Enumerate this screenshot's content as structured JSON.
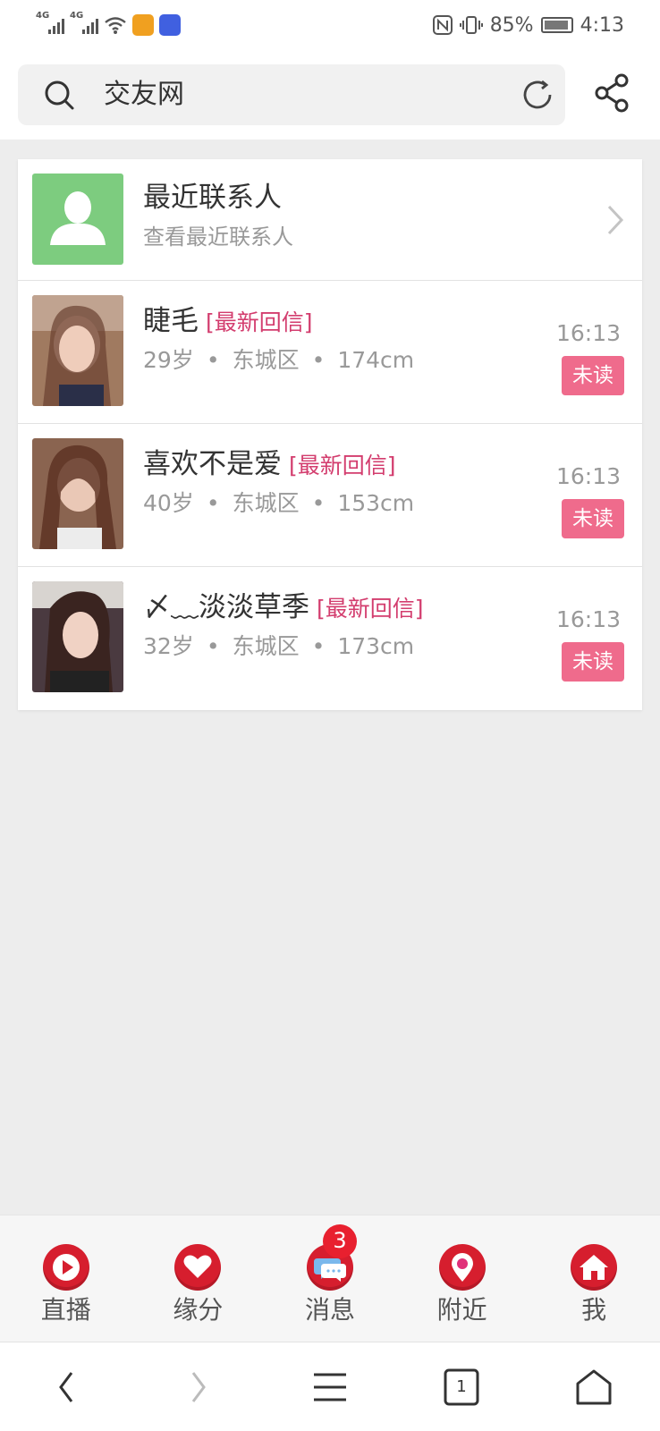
{
  "status_bar": {
    "net1": "4G",
    "net2": "4G",
    "battery_percent": "85%",
    "time": "4:13"
  },
  "search": {
    "text": "交友网"
  },
  "recent_contacts": {
    "title": "最近联系人",
    "subtitle": "查看最近联系人"
  },
  "messages": [
    {
      "name": "睫毛",
      "tag": "[最新回信]",
      "age": "29岁",
      "district": "东城区",
      "height": "174cm",
      "time": "16:13",
      "status": "未读"
    },
    {
      "name": "喜欢不是爱",
      "tag": "[最新回信]",
      "age": "40岁",
      "district": "东城区",
      "height": "153cm",
      "time": "16:13",
      "status": "未读"
    },
    {
      "name": "〆﹏淡淡草季",
      "tag": "[最新回信]",
      "age": "32岁",
      "district": "东城区",
      "height": "173cm",
      "time": "16:13",
      "status": "未读"
    }
  ],
  "separator": "•",
  "tabs": [
    {
      "label": "直播",
      "icon": "play-icon"
    },
    {
      "label": "缘分",
      "icon": "heart-icon"
    },
    {
      "label": "消息",
      "icon": "chat-icon",
      "badge": "3"
    },
    {
      "label": "附近",
      "icon": "location-pin-icon"
    },
    {
      "label": "我",
      "icon": "home-icon"
    }
  ],
  "navbar": {
    "tab_count": "1"
  },
  "colors": {
    "accent_red": "#d61e2e",
    "tag_pink": "#d33d6e",
    "unread_pink": "#ef6b8c",
    "avatar_green": "#7dcc7f"
  }
}
